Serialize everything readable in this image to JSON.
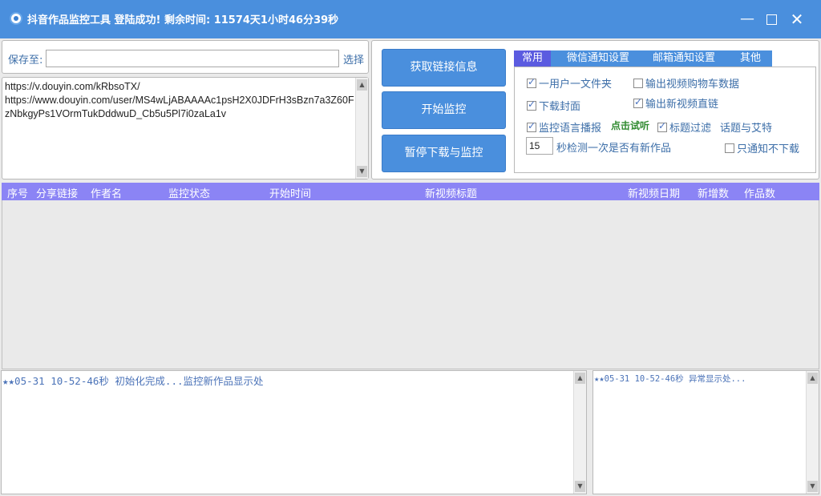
{
  "window": {
    "title": "抖音作品监控工具 登陆成功! 剩余时间: 11574天1小时46分39秒",
    "minimize": "—",
    "close": "✕"
  },
  "save": {
    "label": "保存至:",
    "value": "",
    "choose": "选择"
  },
  "urls": {
    "text": "https://v.douyin.com/kRbsoTX/\nhttps://www.douyin.com/user/MS4wLjABAAAAc1psH2X0JDFrH3sBzn7a3Z60FzNbkgyPs1VOrmTukDddwuD_Cb5u5Pl7i0zaLa1v"
  },
  "buttons": {
    "fetch": "获取链接信息",
    "start": "开始监控",
    "pause": "暂停下载与监控"
  },
  "tabs": [
    {
      "label": "常用",
      "active": true
    },
    {
      "label": "微信通知设置",
      "active": false
    },
    {
      "label": "邮箱通知设置",
      "active": false
    },
    {
      "label": "其他",
      "active": false
    }
  ],
  "options": {
    "one_folder": {
      "label": "一用户一文件夹",
      "checked": true
    },
    "cart_data": {
      "label": "输出视频购物车数据",
      "checked": false
    },
    "download_cover": {
      "label": "下载封面",
      "checked": true
    },
    "direct_link": {
      "label": "输出新视频直链",
      "checked": true
    },
    "voice": {
      "label": "监控语言播报",
      "checked": true
    },
    "trial": "点击试听",
    "title_filter": {
      "label": "标题过滤",
      "checked": true
    },
    "topic": "话题与艾特",
    "interval_value": "15",
    "interval_text": "秒检测一次是否有新作品",
    "notify_only": {
      "label": "只通知不下载",
      "checked": false
    }
  },
  "grid": {
    "columns": [
      "序号",
      "分享链接",
      "作者名",
      "监控状态",
      "开始时间",
      "新视频标题",
      "新视频日期",
      "新增数",
      "作品数"
    ]
  },
  "logs": {
    "main": "★★05-31 10-52-46秒  初始化完成...监控新作品显示处",
    "error": "★★05-31 10-52-46秒  异常显示处..."
  },
  "colors": {
    "accent": "#4a8fdd",
    "grid_header": "#8b84f5",
    "active_tab": "#5b5be0",
    "label_text": "#3c6ea8",
    "trial_text": "#2f8a2f"
  },
  "icons": {
    "app": "app-logo-icon",
    "scroll_up": "▲",
    "scroll_down": "▼"
  }
}
